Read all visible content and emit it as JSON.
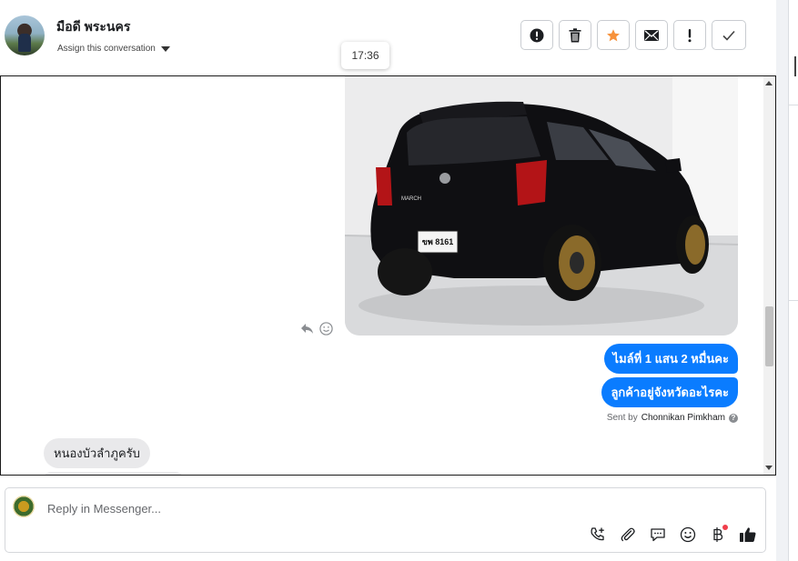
{
  "header": {
    "contact_name": "มือดี พระนคร",
    "assign_label": "Assign this conversation",
    "timestamp_tooltip": "17:36",
    "actions": [
      {
        "name": "mark-spam",
        "icon": "exclamation-circle-icon"
      },
      {
        "name": "delete",
        "icon": "trash-icon"
      },
      {
        "name": "star",
        "icon": "star-icon",
        "color": "#f7923b"
      },
      {
        "name": "mark-unread",
        "icon": "envelope-icon"
      },
      {
        "name": "follow-up",
        "icon": "exclamation-icon"
      },
      {
        "name": "mark-done",
        "icon": "check-icon"
      }
    ]
  },
  "conversation": {
    "outgoing_messages": [
      "ไมล์ที่ 1 แสน 2 หมื่นคะ",
      "ลูกค้าอยู่จังหวัดอะไรคะ"
    ],
    "sent_by_prefix": "Sent by",
    "sent_by_agent": "Chonnikan Pimkham",
    "incoming_messages": [
      "หนองบัวลำภูครับ"
    ],
    "license_plate": "ขพ 8161",
    "car_badge": "MARCH"
  },
  "composer": {
    "placeholder": "Reply in Messenger...",
    "tools": [
      "add-call-icon",
      "attachment-icon",
      "saved-reply-icon",
      "emoji-icon",
      "baht-payment-icon",
      "thumbs-up-icon"
    ]
  },
  "colors": {
    "outgoing_bubble": "#0a7cff",
    "incoming_bubble": "#e9e9eb",
    "star": "#f7923b",
    "notification_dot": "#f03e4b"
  }
}
